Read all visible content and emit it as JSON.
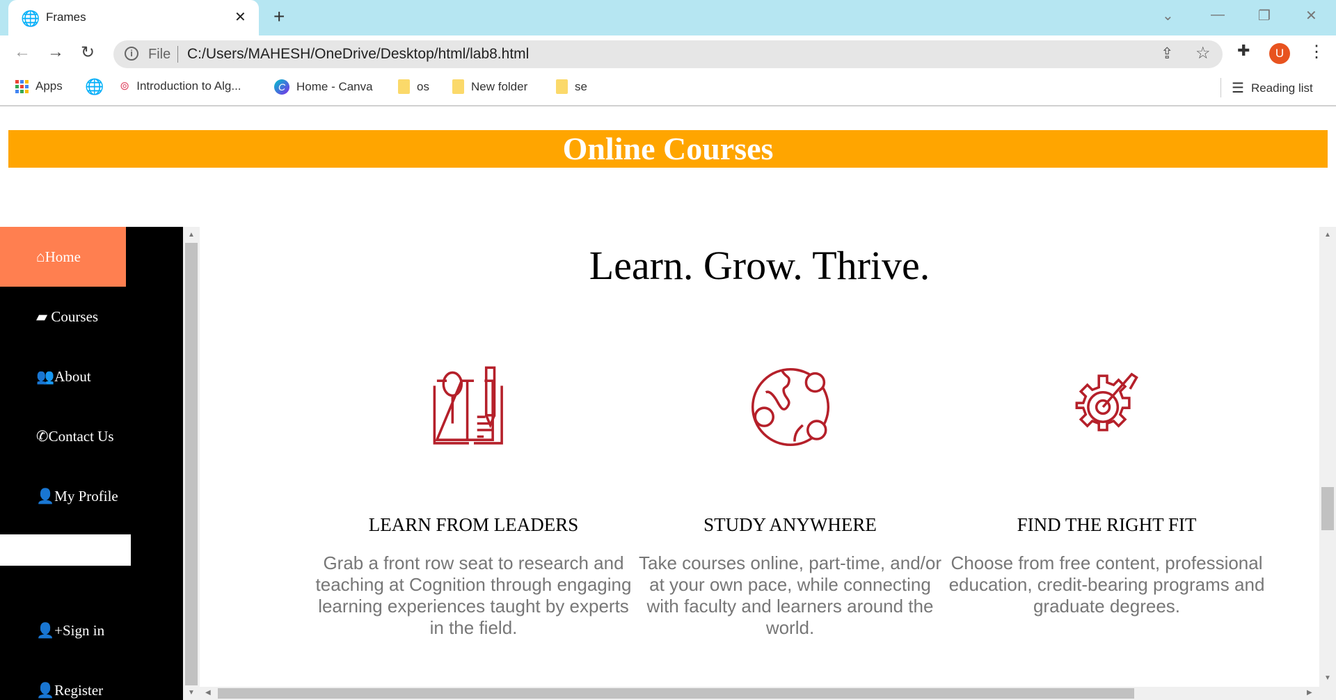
{
  "browser": {
    "tab_title": "Frames",
    "omnibox": {
      "scheme_label": "File",
      "url": "C:/Users/MAHESH/OneDrive/Desktop/html/lab8.html"
    },
    "avatar_letter": "U",
    "bookmarks": [
      {
        "label": "Apps"
      },
      {
        "label": ""
      },
      {
        "label": "Introduction to Alg..."
      },
      {
        "label": "Home - Canva"
      },
      {
        "label": "os"
      },
      {
        "label": "New folder"
      },
      {
        "label": "se"
      }
    ],
    "reading_list": "Reading list"
  },
  "page": {
    "banner": "Online Courses",
    "sidebar": [
      {
        "label": "Home",
        "icon": "home-icon"
      },
      {
        "label": " Courses",
        "icon": "book-icon"
      },
      {
        "label": "About",
        "icon": "users-icon"
      },
      {
        "label": "Contact Us",
        "icon": "phone-icon"
      },
      {
        "label": "My Profile",
        "icon": "user-icon"
      },
      {
        "label": "Sign in",
        "icon": "user-plus-icon"
      },
      {
        "label": "Register",
        "icon": "user-icon"
      }
    ],
    "headline": "Learn. Grow. Thrive.",
    "features": [
      {
        "title": "LEARN FROM LEADERS",
        "text": "Grab a front row seat to research and teaching at Cognition through engaging learning experiences taught by experts in the field."
      },
      {
        "title": "STUDY ANYWHERE",
        "text": "Take courses online, part-time, and/or at your own pace, while connecting with faculty and learners around the world."
      },
      {
        "title": "FIND THE RIGHT FIT",
        "text": "Choose from free content, professional education, credit-bearing programs and graduate degrees."
      }
    ],
    "colors": {
      "banner": "#ffa500",
      "active_nav": "#ff7f50",
      "icon": "#b5202a"
    }
  }
}
